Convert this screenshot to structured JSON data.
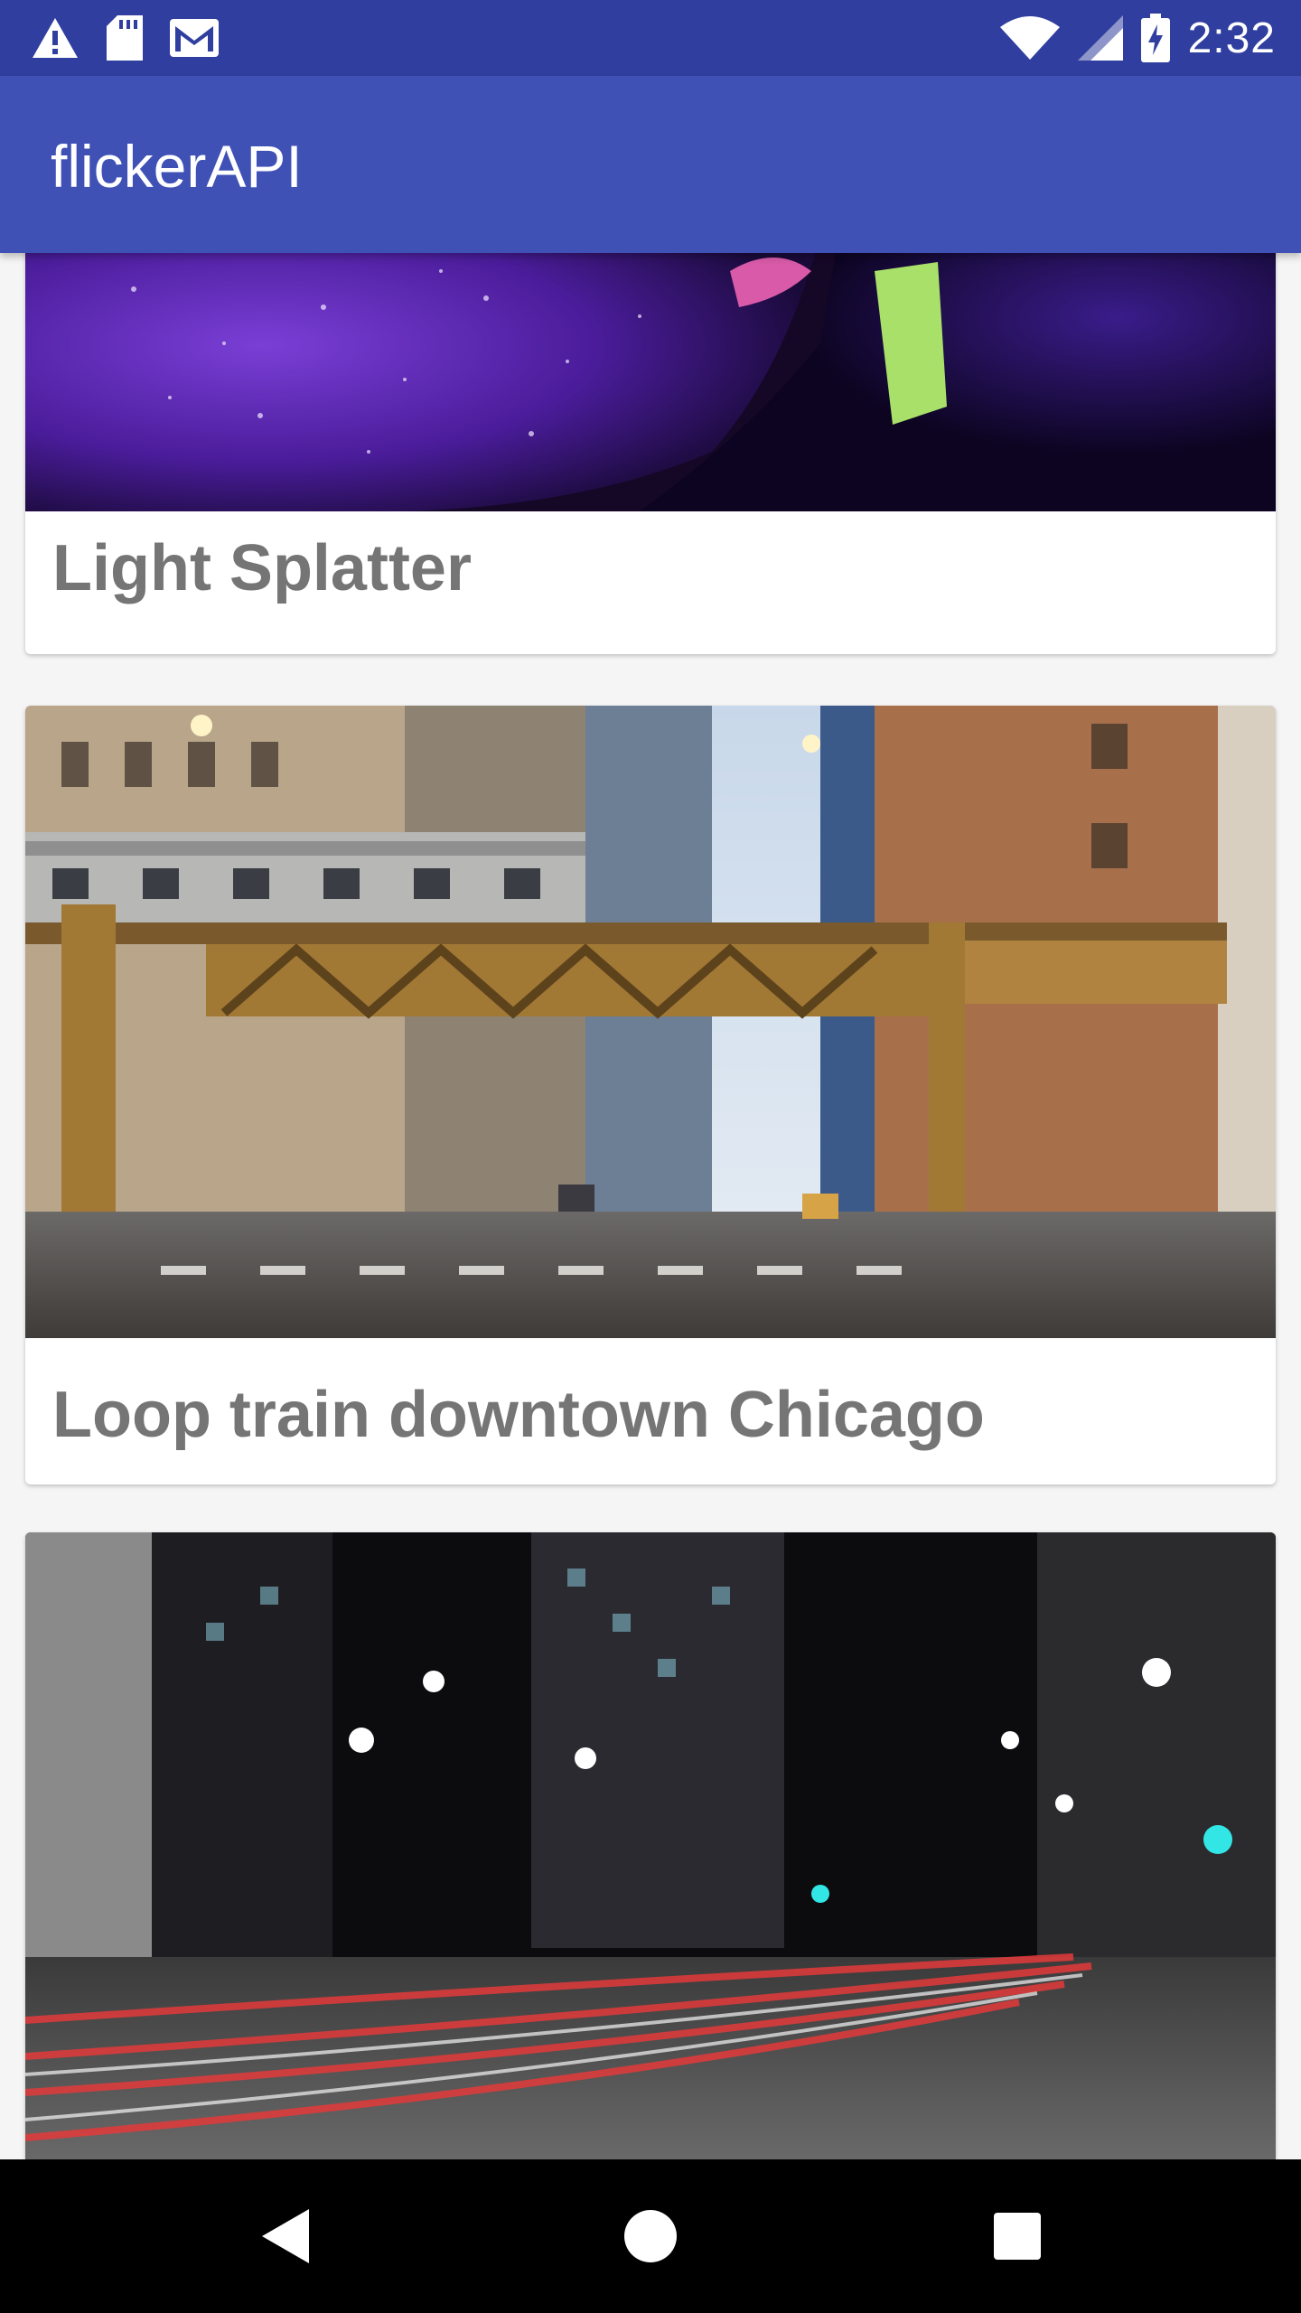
{
  "status_bar": {
    "time": "2:32",
    "left_icons": [
      "warning-icon",
      "sd-card-icon",
      "gmail-icon"
    ],
    "right_icons": [
      "wifi-icon",
      "signal-icon",
      "battery-charging-icon"
    ]
  },
  "app_bar": {
    "title": "flickerAPI"
  },
  "feed": {
    "items": [
      {
        "caption": "Light Splatter",
        "image": "glitter-face-photo"
      },
      {
        "caption": "Loop train downtown Chicago",
        "image": "chicago-loop-train-photo"
      },
      {
        "caption": "",
        "image": "night-city-street-photo"
      }
    ]
  },
  "nav_bar": {
    "buttons": [
      "back-icon",
      "home-icon",
      "recents-icon"
    ]
  },
  "colors": {
    "status_bar": "#303f9f",
    "app_bar": "#3f51b5",
    "caption_text": "#757575",
    "background": "#f5f5f5"
  }
}
